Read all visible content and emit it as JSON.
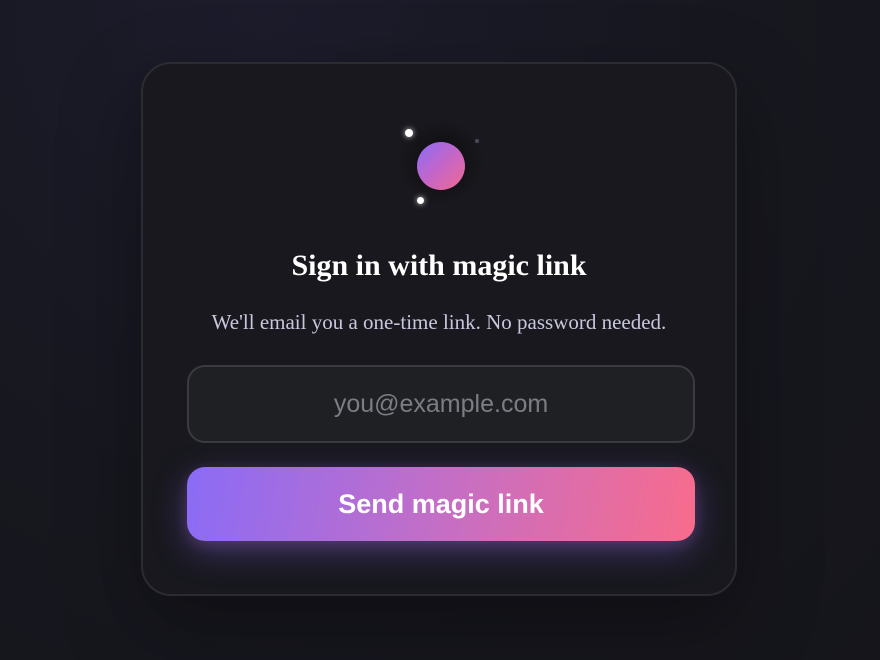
{
  "card": {
    "title": "Sign in with magic link",
    "subtitle": "We'll email you a one-time link. No password needed.",
    "email_placeholder": "you@example.com",
    "email_value": "",
    "submit_label": "Send magic link"
  },
  "icons": {
    "logo": "magic-orb-icon",
    "sparkles": "sparkle-icon"
  },
  "colors": {
    "background": "#17171f",
    "card_background": "#18181e",
    "card_border": "#2b2b31",
    "input_background": "#1f2024",
    "gradient_start": "#8a6cf6",
    "gradient_end": "#f86c8c",
    "title_text": "#ffffff",
    "subtitle_text": "#c9c7dd"
  }
}
